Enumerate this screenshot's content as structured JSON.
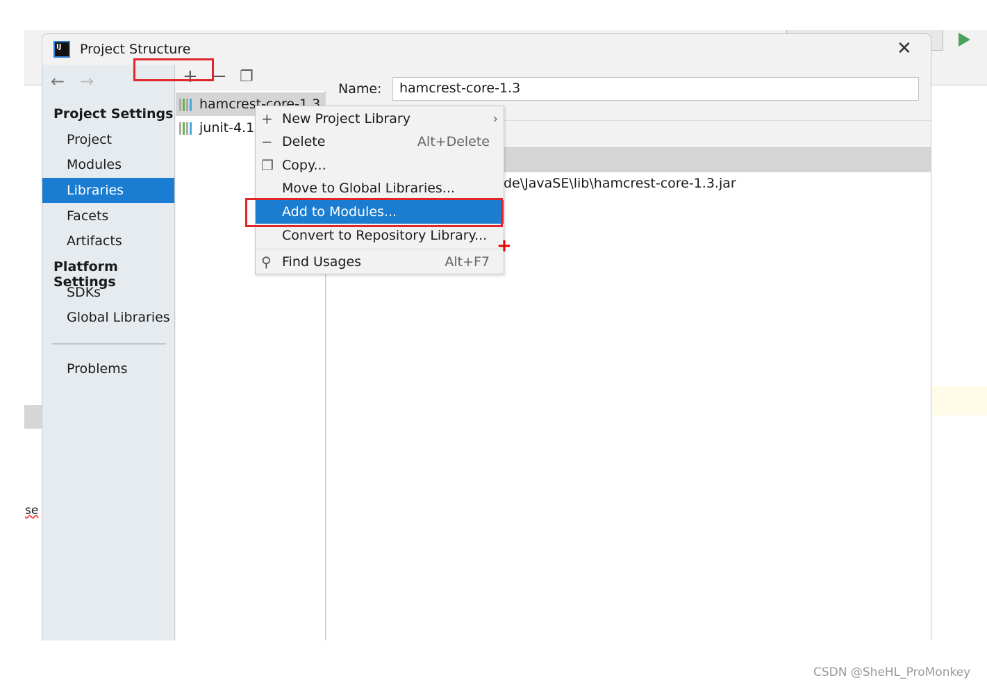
{
  "dialog": {
    "title": "Project Structure",
    "logo": "IJ"
  },
  "sidebar": {
    "project_settings": "Project Settings",
    "items": [
      {
        "label": "Project"
      },
      {
        "label": "Modules"
      },
      {
        "label": "Libraries",
        "selected": true
      },
      {
        "label": "Facets"
      },
      {
        "label": "Artifacts"
      }
    ],
    "platform_settings": "Platform Settings",
    "platform_items": [
      {
        "label": "SDKs"
      },
      {
        "label": "Global Libraries"
      }
    ],
    "problems": "Problems"
  },
  "libraries": [
    "hamcrest-core-1.3",
    "junit-4.12"
  ],
  "detail": {
    "name_label": "Name:",
    "name_value": "hamcrest-core-1.3",
    "path_fragment": "de\\JavaSE\\lib\\hamcrest-core-1.3.jar"
  },
  "context_menu": {
    "items": [
      {
        "icon": "plus-icon",
        "label": "New Project Library",
        "submenu": true
      },
      {
        "icon": "minus-icon",
        "label": "Delete",
        "shortcut": "Alt+Delete"
      },
      {
        "icon": "copy-icon",
        "label": "Copy..."
      },
      {
        "label": "Move to Global Libraries..."
      },
      {
        "label": "Add to Modules...",
        "highlighted": true
      },
      {
        "label": "Convert to Repository Library..."
      },
      {
        "icon": "search-icon",
        "label": "Find Usages",
        "shortcut": "Alt+F7"
      }
    ]
  },
  "background_fragment": "se",
  "watermark": "CSDN @SheHL_ProMonkey",
  "colors": {
    "selection": "#1b7dd1",
    "annotation": "#e0262b",
    "run": "#4aa35a"
  }
}
